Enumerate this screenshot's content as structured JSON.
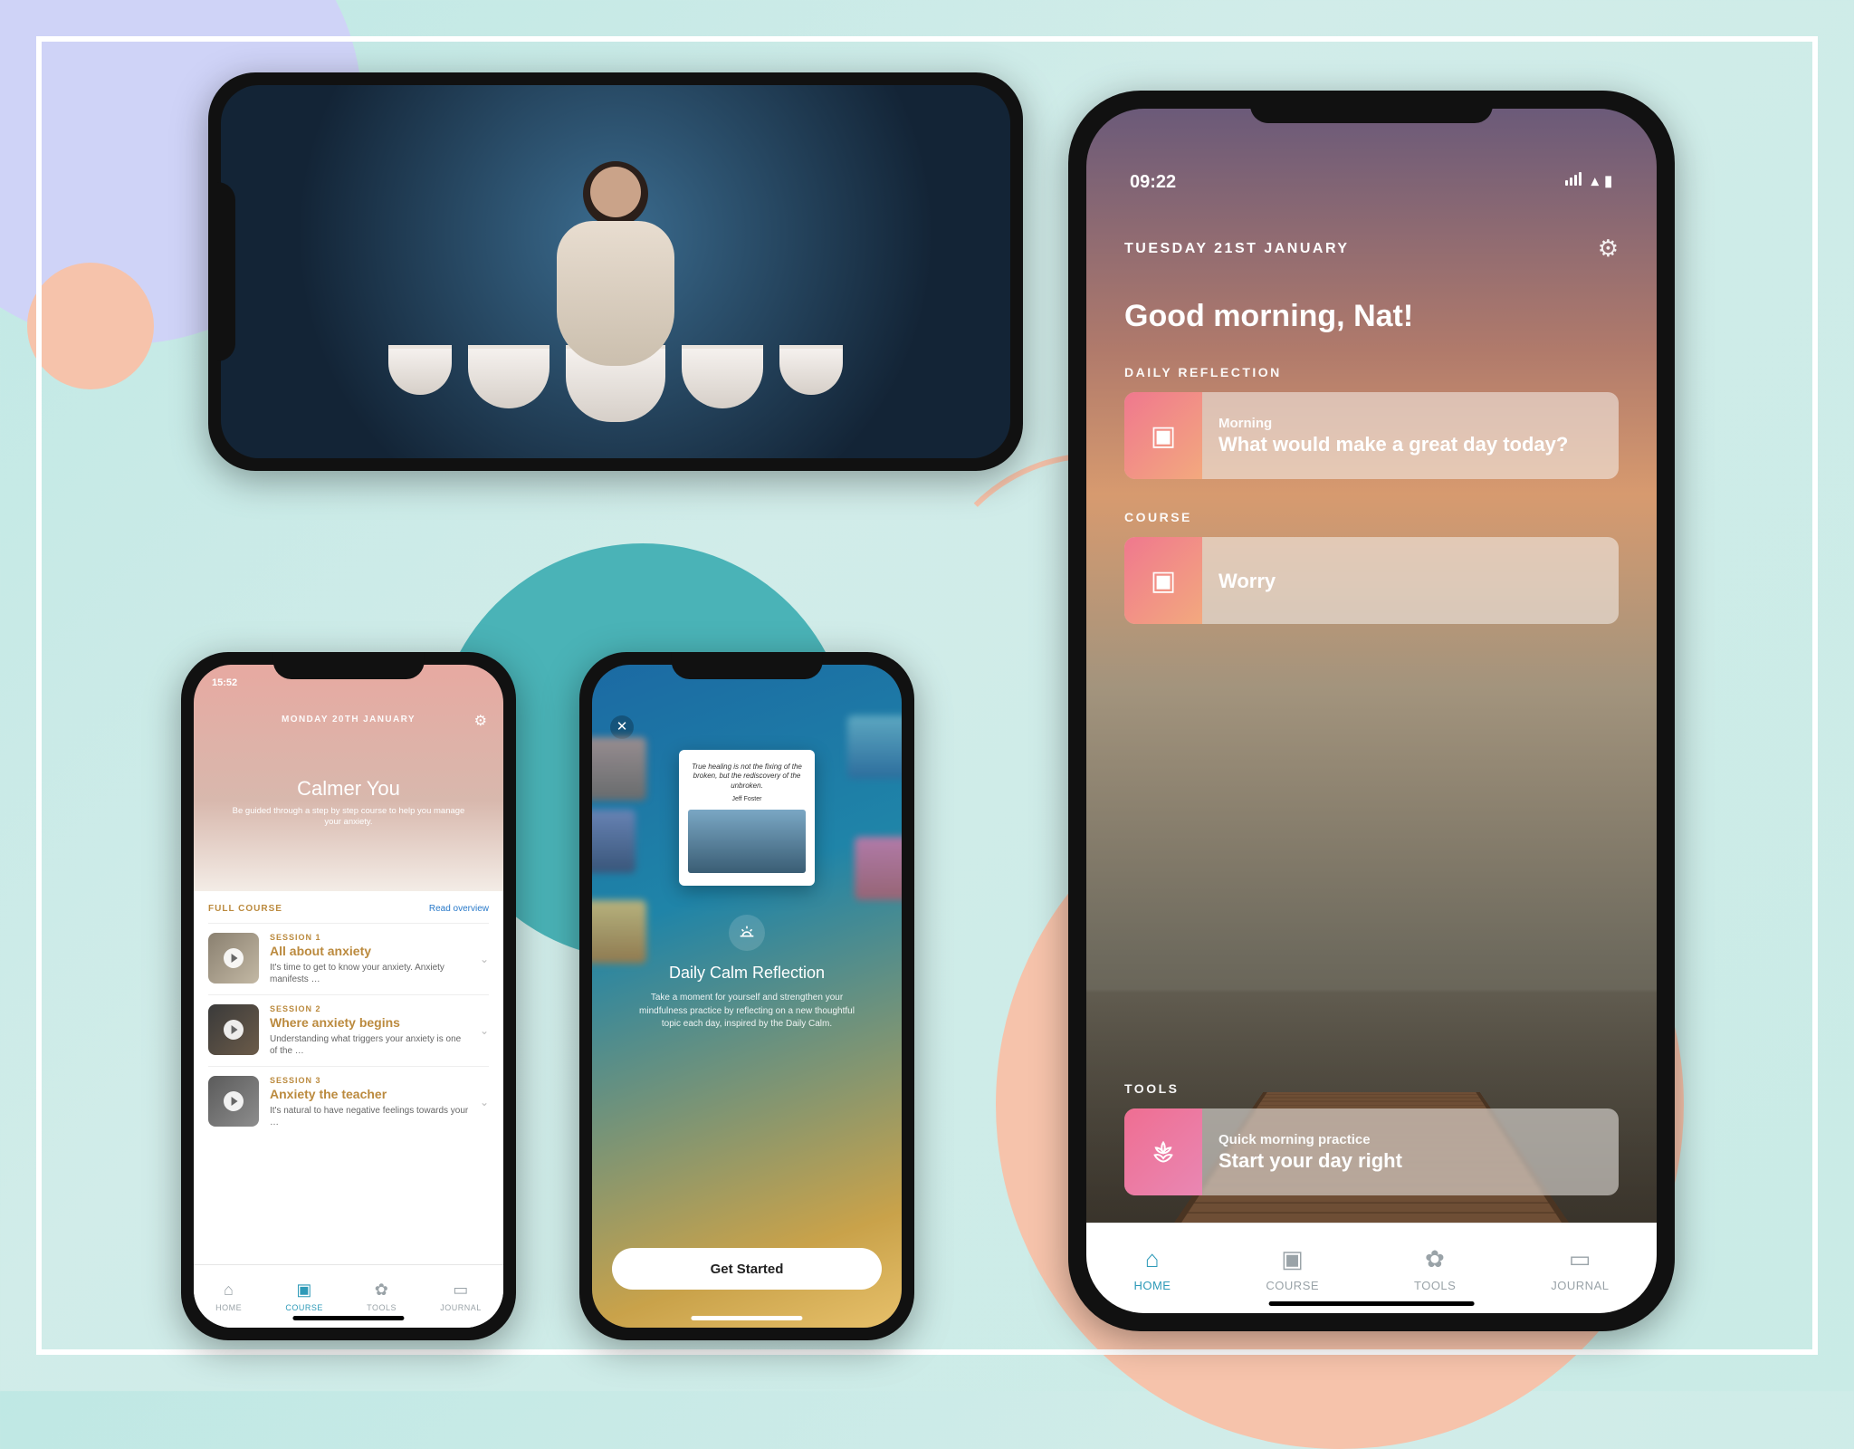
{
  "landscape": {},
  "course": {
    "status_time": "15:52",
    "date": "MONDAY 20TH JANUARY",
    "title": "Calmer You",
    "subtitle": "Be guided through a step by step course to help you manage your anxiety.",
    "section": "FULL COURSE",
    "read_overview": "Read overview",
    "sessions": [
      {
        "label": "SESSION 1",
        "title": "All about anxiety",
        "desc": "It's time to get to know your anxiety. Anxiety manifests …"
      },
      {
        "label": "SESSION 2",
        "title": "Where anxiety begins",
        "desc": "Understanding what triggers your anxiety is one of the …"
      },
      {
        "label": "SESSION 3",
        "title": "Anxiety the teacher",
        "desc": "It's natural to have negative feelings towards your …"
      }
    ],
    "tabs": {
      "home": "HOME",
      "course": "COURSE",
      "tools": "TOOLS",
      "journal": "JOURNAL"
    }
  },
  "reflection": {
    "quote": "True healing is not the fixing of the broken, but the rediscovery of the unbroken.",
    "quote_author": "Jeff Foster",
    "title": "Daily Calm Reflection",
    "desc": "Take a moment for yourself and strengthen your mindfulness practice by reflecting on a new thoughtful topic each day, inspired by the Daily Calm.",
    "get_started": "Get Started"
  },
  "home": {
    "status_time": "09:22",
    "date": "TUESDAY 21ST JANUARY",
    "greeting": "Good morning, Nat!",
    "sections": {
      "daily": "DAILY REFLECTION",
      "daily_sub": "Morning",
      "daily_title": "What would make a great day today?",
      "course": "COURSE",
      "course_title": "Worry",
      "tools": "TOOLS",
      "tools_sub": "Quick morning practice",
      "tools_title": "Start your day right"
    },
    "tabs": {
      "home": "HOME",
      "course": "COURSE",
      "tools": "TOOLS",
      "journal": "JOURNAL"
    }
  }
}
